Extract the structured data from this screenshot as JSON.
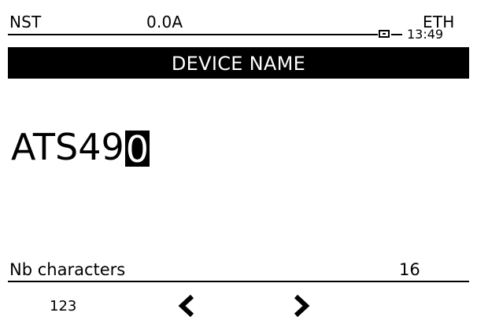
{
  "status_bar": {
    "mode": "NST",
    "current": "0.0A",
    "comm": "ETH",
    "time": "13:49"
  },
  "title": "DEVICE NAME",
  "device_name": {
    "text": "ATS49",
    "cursor_char": "0"
  },
  "nb_characters": {
    "label": "Nb characters",
    "value": "16"
  },
  "softkeys": {
    "left_label": "123",
    "prev_icon": "chevron-left-icon",
    "next_icon": "chevron-right-icon"
  }
}
